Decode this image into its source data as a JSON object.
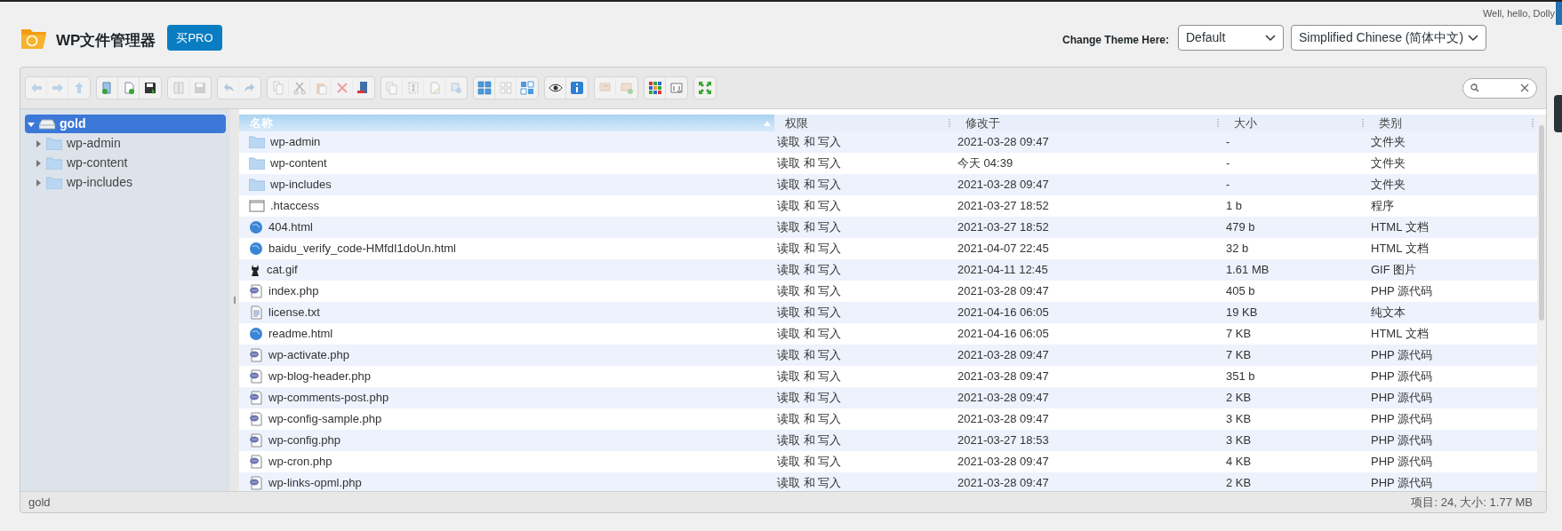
{
  "brand": {
    "title": "WP文件管理器",
    "buy_button": "买PRO"
  },
  "greeting": "Well, hello, Dolly",
  "theme": {
    "label": "Change Theme Here:",
    "theme_select": "Default",
    "language_select": "Simplified Chinese (简体中文)"
  },
  "toolbar": {
    "groups": [
      [
        {
          "kind": "back",
          "disabled": true
        },
        {
          "kind": "forward",
          "disabled": true
        },
        {
          "kind": "up",
          "disabled": true
        }
      ],
      [
        {
          "kind": "new-folder",
          "disabled": false
        },
        {
          "kind": "new-file",
          "disabled": false
        },
        {
          "kind": "upload",
          "disabled": false
        }
      ],
      [
        {
          "kind": "open",
          "disabled": true
        },
        {
          "kind": "download",
          "disabled": true
        }
      ],
      [
        {
          "kind": "undo",
          "disabled": true
        },
        {
          "kind": "redo",
          "disabled": true
        }
      ],
      [
        {
          "kind": "copy",
          "disabled": true
        },
        {
          "kind": "cut",
          "disabled": true
        },
        {
          "kind": "paste",
          "disabled": true
        },
        {
          "kind": "delete",
          "disabled": true
        },
        {
          "kind": "empty",
          "disabled": false
        }
      ],
      [
        {
          "kind": "duplicate",
          "disabled": true
        },
        {
          "kind": "select",
          "disabled": true
        },
        {
          "kind": "edit",
          "disabled": true
        },
        {
          "kind": "resize",
          "disabled": true
        }
      ],
      [
        {
          "kind": "icons-view",
          "disabled": false
        },
        {
          "kind": "small-view",
          "disabled": true
        },
        {
          "kind": "mixed-view",
          "disabled": false
        }
      ],
      [
        {
          "kind": "preview",
          "disabled": false
        },
        {
          "kind": "info",
          "disabled": false
        }
      ],
      [
        {
          "kind": "extract",
          "disabled": true
        },
        {
          "kind": "archive",
          "disabled": true
        }
      ],
      [
        {
          "kind": "grid",
          "disabled": false
        },
        {
          "kind": "sort",
          "disabled": false
        }
      ],
      [
        {
          "kind": "fullscreen",
          "disabled": false
        }
      ]
    ]
  },
  "tree": [
    {
      "label": "gold",
      "expanded": true,
      "selected": true,
      "children": [
        {
          "label": "wp-admin",
          "expanded": false,
          "selected": false
        },
        {
          "label": "wp-content",
          "expanded": false,
          "selected": false
        },
        {
          "label": "wp-includes",
          "expanded": false,
          "selected": false
        }
      ]
    }
  ],
  "table": {
    "columns": [
      {
        "label": "名称",
        "sorted": true
      },
      {
        "label": "权限",
        "sorted": false
      },
      {
        "label": "修改于",
        "sorted": false
      },
      {
        "label": "大小",
        "sorted": false
      },
      {
        "label": "类别",
        "sorted": false
      }
    ],
    "rows": [
      {
        "kind": "folder",
        "name": "wp-admin",
        "permissions": "读取 和 写入",
        "modified": "2021-03-28 09:47",
        "size": "-",
        "type": "文件夹"
      },
      {
        "kind": "folder",
        "name": "wp-content",
        "permissions": "读取 和 写入",
        "modified": "今天 04:39",
        "size": "-",
        "type": "文件夹"
      },
      {
        "kind": "folder",
        "name": "wp-includes",
        "permissions": "读取 和 写入",
        "modified": "2021-03-28 09:47",
        "size": "-",
        "type": "文件夹"
      },
      {
        "kind": "file",
        "name": ".htaccess",
        "permissions": "读取 和 写入",
        "modified": "2021-03-27 18:52",
        "size": "1 b",
        "type": "程序"
      },
      {
        "kind": "html",
        "name": "404.html",
        "permissions": "读取 和 写入",
        "modified": "2021-03-27 18:52",
        "size": "479 b",
        "type": "HTML 文档"
      },
      {
        "kind": "html",
        "name": "baidu_verify_code-HMfdI1doUn.html",
        "permissions": "读取 和 写入",
        "modified": "2021-04-07 22:45",
        "size": "32 b",
        "type": "HTML 文档"
      },
      {
        "kind": "image",
        "name": "cat.gif",
        "permissions": "读取 和 写入",
        "modified": "2021-04-11 12:45",
        "size": "1.61 MB",
        "type": "GIF 图片"
      },
      {
        "kind": "php",
        "name": "index.php",
        "permissions": "读取 和 写入",
        "modified": "2021-03-28 09:47",
        "size": "405 b",
        "type": "PHP 源代码"
      },
      {
        "kind": "text",
        "name": "license.txt",
        "permissions": "读取 和 写入",
        "modified": "2021-04-16 06:05",
        "size": "19 KB",
        "type": "纯文本"
      },
      {
        "kind": "html",
        "name": "readme.html",
        "permissions": "读取 和 写入",
        "modified": "2021-04-16 06:05",
        "size": "7 KB",
        "type": "HTML 文档"
      },
      {
        "kind": "php",
        "name": "wp-activate.php",
        "permissions": "读取 和 写入",
        "modified": "2021-03-28 09:47",
        "size": "7 KB",
        "type": "PHP 源代码"
      },
      {
        "kind": "php",
        "name": "wp-blog-header.php",
        "permissions": "读取 和 写入",
        "modified": "2021-03-28 09:47",
        "size": "351 b",
        "type": "PHP 源代码"
      },
      {
        "kind": "php",
        "name": "wp-comments-post.php",
        "permissions": "读取 和 写入",
        "modified": "2021-03-28 09:47",
        "size": "2 KB",
        "type": "PHP 源代码"
      },
      {
        "kind": "php",
        "name": "wp-config-sample.php",
        "permissions": "读取 和 写入",
        "modified": "2021-03-28 09:47",
        "size": "3 KB",
        "type": "PHP 源代码"
      },
      {
        "kind": "php",
        "name": "wp-config.php",
        "permissions": "读取 和 写入",
        "modified": "2021-03-27 18:53",
        "size": "3 KB",
        "type": "PHP 源代码"
      },
      {
        "kind": "php",
        "name": "wp-cron.php",
        "permissions": "读取 和 写入",
        "modified": "2021-03-28 09:47",
        "size": "4 KB",
        "type": "PHP 源代码"
      },
      {
        "kind": "php",
        "name": "wp-links-opml.php",
        "permissions": "读取 和 写入",
        "modified": "2021-03-28 09:47",
        "size": "2 KB",
        "type": "PHP 源代码"
      }
    ]
  },
  "status_bar": {
    "path": "gold",
    "summary": "项目: 24, 大小: 1.77 MB"
  }
}
